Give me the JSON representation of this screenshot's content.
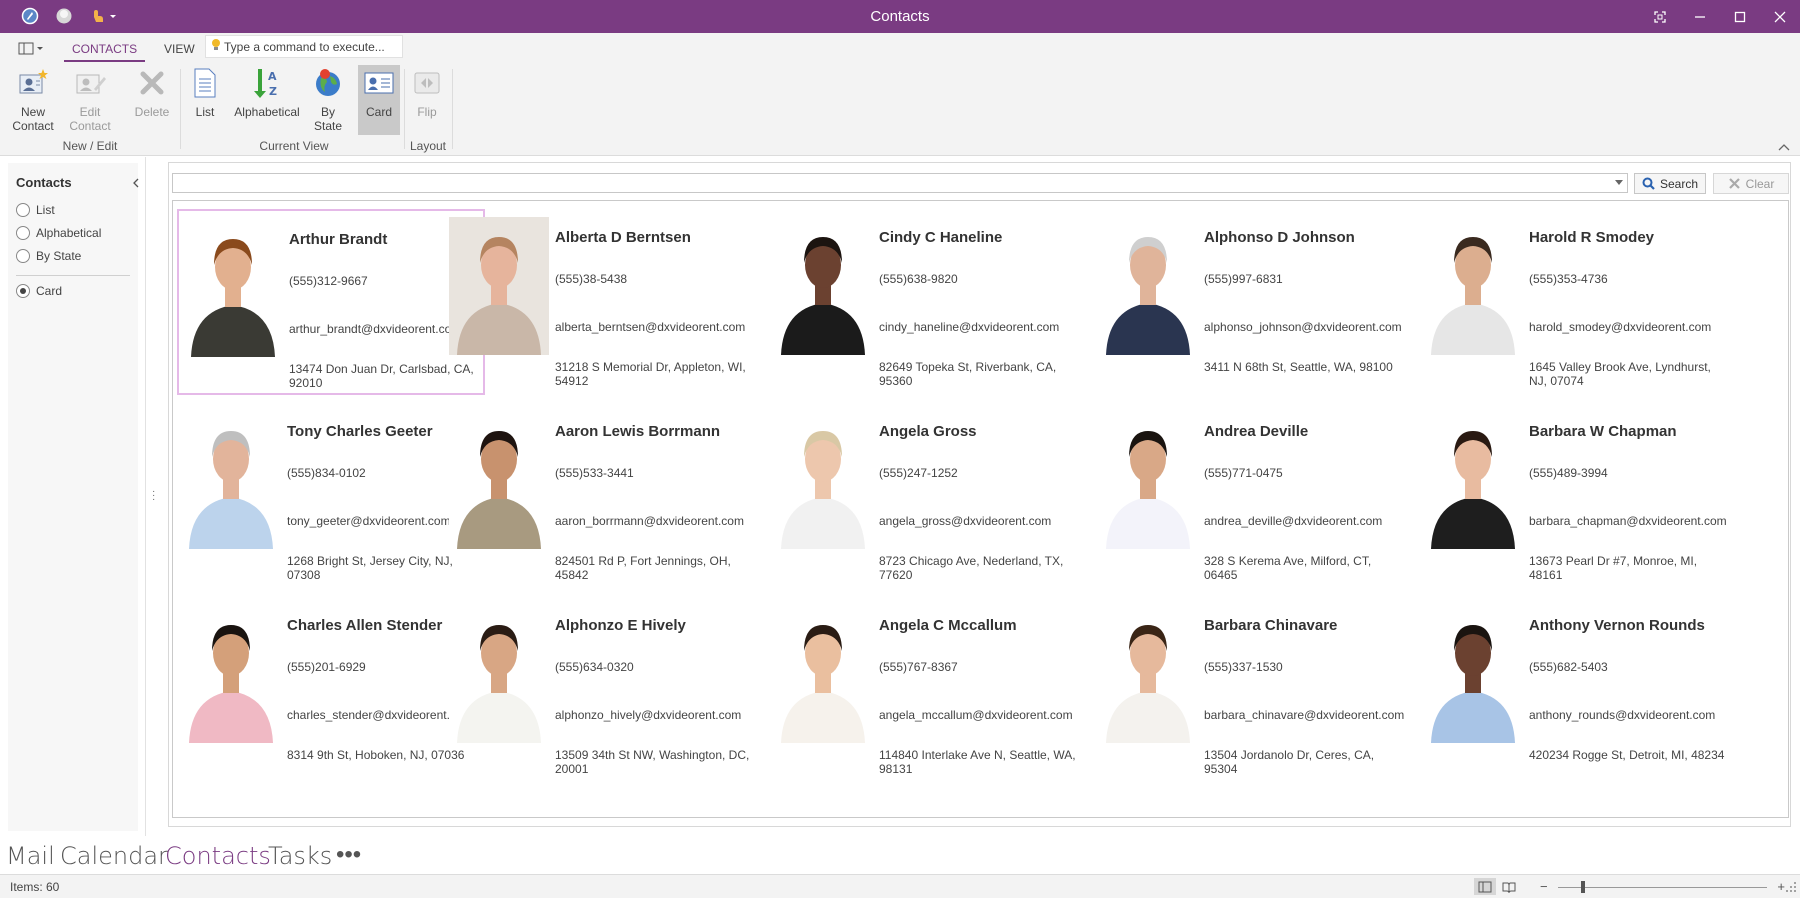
{
  "window": {
    "title": "Contacts"
  },
  "ribbon": {
    "tabs": [
      {
        "label": "CONTACTS",
        "active": true
      },
      {
        "label": "VIEW",
        "active": false
      }
    ],
    "command_placeholder": "Type a command to execute...",
    "groups": [
      {
        "label": "New / Edit"
      },
      {
        "label": "Current View"
      },
      {
        "label": "Layout"
      }
    ],
    "buttons": {
      "new_contact": "New\nContact",
      "edit_contact": "Edit\nContact",
      "delete": "Delete",
      "list": "List",
      "alphabetical": "Alphabetical",
      "by_state": "By\nState",
      "card": "Card",
      "flip": "Flip"
    }
  },
  "nav": {
    "title": "Contacts",
    "items": [
      {
        "label": "List",
        "selected": false
      },
      {
        "label": "Alphabetical",
        "selected": false
      },
      {
        "label": "By State",
        "selected": false
      },
      {
        "label": "Card",
        "selected": true
      }
    ]
  },
  "search": {
    "value": "",
    "search_label": "Search",
    "clear_label": "Clear"
  },
  "contacts": [
    {
      "name": "Arthur Brandt",
      "phone": "(555)312-9667",
      "email": "arthur_brandt@dxvideorent.com",
      "address": "13474 Don Juan Dr, Carlsbad, CA, 92010",
      "selected": true
    },
    {
      "name": "Alberta D Berntsen",
      "phone": "(555)38-5438",
      "email": "alberta_berntsen@dxvideorent.com",
      "address": "31218 S Memorial Dr, Appleton, WI, 54912"
    },
    {
      "name": "Cindy C Haneline",
      "phone": "(555)638-9820",
      "email": "cindy_haneline@dxvideorent.com",
      "address": "82649 Topeka St, Riverbank, CA, 95360"
    },
    {
      "name": "Alphonso D Johnson",
      "phone": "(555)997-6831",
      "email": "alphonso_johnson@dxvideorent.com",
      "address": "3411 N 68th St, Seattle, WA, 98100"
    },
    {
      "name": "Harold R Smodey",
      "phone": "(555)353-4736",
      "email": "harold_smodey@dxvideorent.com",
      "address": "1645 Valley Brook Ave, Lyndhurst, NJ, 07074"
    },
    {
      "name": "Tony Charles Geeter",
      "phone": "(555)834-0102",
      "email": "tony_geeter@dxvideorent.com",
      "address": "1268 Bright St, Jersey City, NJ, 07308"
    },
    {
      "name": "Aaron Lewis Borrmann",
      "phone": "(555)533-3441",
      "email": "aaron_borrmann@dxvideorent.com",
      "address": "824501 Rd P, Fort Jennings, OH, 45842"
    },
    {
      "name": "Angela Gross",
      "phone": "(555)247-1252",
      "email": "angela_gross@dxvideorent.com",
      "address": "8723 Chicago Ave, Nederland, TX, 77620"
    },
    {
      "name": "Andrea Deville",
      "phone": "(555)771-0475",
      "email": "andrea_deville@dxvideorent.com",
      "address": "328 S Kerema Ave, Milford, CT, 06465"
    },
    {
      "name": "Barbara W Chapman",
      "phone": "(555)489-3994",
      "email": "barbara_chapman@dxvideorent.com",
      "address": "13673 Pearl Dr #7, Monroe, MI, 48161"
    },
    {
      "name": "Charles Allen Stender",
      "phone": "(555)201-6929",
      "email": "charles_stender@dxvideorent.com",
      "address": "8314 9th St, Hoboken, NJ, 07036"
    },
    {
      "name": "Alphonzo E Hively",
      "phone": "(555)634-0320",
      "email": "alphonzo_hively@dxvideorent.com",
      "address": "13509 34th St NW, Washington, DC, 20001"
    },
    {
      "name": "Angela C Mccallum",
      "phone": "(555)767-8367",
      "email": "angela_mccallum@dxvideorent.com",
      "address": "114840 Interlake Ave N, Seattle, WA, 98131"
    },
    {
      "name": "Barbara Chinavare",
      "phone": "(555)337-1530",
      "email": "barbara_chinavare@dxvideorent.com",
      "address": "13504 Jordanolo Dr, Ceres, CA, 95304"
    },
    {
      "name": "Anthony Vernon Rounds",
      "phone": "(555)682-5403",
      "email": "anthony_rounds@dxvideorent.com",
      "address": "420234 Rogge St, Detroit, MI, 48234"
    }
  ],
  "photo_palette": [
    {
      "bg": "#ffffff",
      "skin": "#e2b08f",
      "hair": "#8a4a1c",
      "shirt": "#3a3a34"
    },
    {
      "bg": "#e9e4de",
      "skin": "#e6b49c",
      "hair": "#b58460",
      "shirt": "#c9b7a8"
    },
    {
      "bg": "#ffffff",
      "skin": "#6b4130",
      "hair": "#1c1410",
      "shirt": "#1b1b1b"
    },
    {
      "bg": "#ffffff",
      "skin": "#e0b49a",
      "hair": "#cfcfcf",
      "shirt": "#2a3550"
    },
    {
      "bg": "#ffffff",
      "skin": "#dcae8f",
      "hair": "#3a2a1f",
      "shirt": "#e6e6e6"
    },
    {
      "bg": "#ffffff",
      "skin": "#e2b49b",
      "hair": "#bfbfbf",
      "shirt": "#bcd3ec"
    },
    {
      "bg": "#ffffff",
      "skin": "#c8926e",
      "hair": "#1e1410",
      "shirt": "#a89a80"
    },
    {
      "bg": "#ffffff",
      "skin": "#edc7ad",
      "hair": "#d9c8a5",
      "shirt": "#f1f1f1"
    },
    {
      "bg": "#ffffff",
      "skin": "#d9a887",
      "hair": "#1a1410",
      "shirt": "#f3f3fa"
    },
    {
      "bg": "#ffffff",
      "skin": "#e8bba0",
      "hair": "#2a1a12",
      "shirt": "#1e1e1e"
    },
    {
      "bg": "#ffffff",
      "skin": "#d4a07a",
      "hair": "#1a1410",
      "shirt": "#f0b9c4"
    },
    {
      "bg": "#ffffff",
      "skin": "#d8a684",
      "hair": "#2a1c14",
      "shirt": "#f4f4f0"
    },
    {
      "bg": "#ffffff",
      "skin": "#eabf9f",
      "hair": "#2a1c14",
      "shirt": "#f6f2ec"
    },
    {
      "bg": "#ffffff",
      "skin": "#e6b99c",
      "hair": "#3a2516",
      "shirt": "#f4f2ee"
    },
    {
      "bg": "#ffffff",
      "skin": "#6b4130",
      "hair": "#1a1410",
      "shirt": "#a8c4e6"
    }
  ],
  "bottom_nav": [
    {
      "label": "Mail",
      "active": false
    },
    {
      "label": "Calendar",
      "active": false
    },
    {
      "label": "Contacts",
      "active": true
    },
    {
      "label": "Tasks",
      "active": false
    },
    {
      "label": "•••",
      "active": false
    }
  ],
  "status": {
    "items_text": "Items: 60",
    "zoom_percent": 12
  },
  "colors": {
    "accent": "#7a3b82",
    "selection_border": "#e5b9e8"
  }
}
